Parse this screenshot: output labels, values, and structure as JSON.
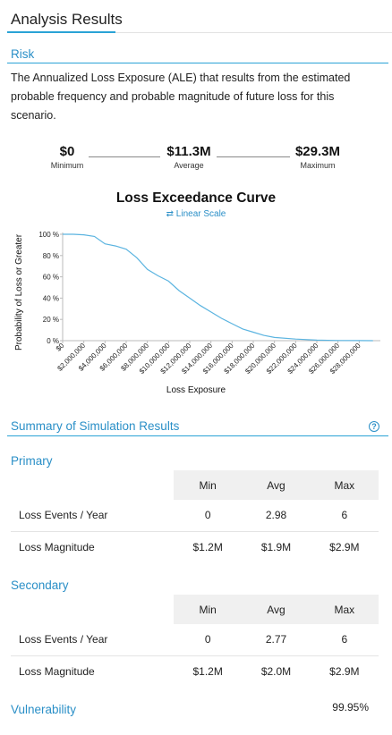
{
  "header": {
    "title": "Analysis Results"
  },
  "risk": {
    "heading": "Risk",
    "description": "The Annualized Loss Exposure (ALE) that results from the estimated probable frequency and probable magnitude of future loss for this scenario.",
    "stats": {
      "min_value": "$0",
      "min_label": "Minimum",
      "avg_value": "$11.3M",
      "avg_label": "Average",
      "max_value": "$29.3M",
      "max_label": "Maximum"
    }
  },
  "chart_data": {
    "type": "line",
    "title": "Loss Exceedance Curve",
    "scale_toggle": "Linear Scale",
    "xlabel": "Loss Exposure",
    "ylabel": "Probability of Loss or Greater",
    "x_ticks": [
      "$0",
      "$2,000,000",
      "$4,000,000",
      "$6,000,000",
      "$8,000,000",
      "$10,000,000",
      "$12,000,000",
      "$14,000,000",
      "$16,000,000",
      "$18,000,000",
      "$20,000,000",
      "$22,000,000",
      "$24,000,000",
      "$26,000,000",
      "$28,000,000"
    ],
    "y_ticks": [
      "0 %",
      "20 %",
      "40 %",
      "60 %",
      "80 %",
      "100 %"
    ],
    "xlim": [
      0,
      30000000
    ],
    "ylim": [
      0,
      100
    ],
    "grid": false,
    "series": [
      {
        "color": "#5bb4e0",
        "x": [
          0,
          1000000,
          2000000,
          3000000,
          4000000,
          5000000,
          6000000,
          7000000,
          8000000,
          9000000,
          10000000,
          11000000,
          12000000,
          13000000,
          14000000,
          15000000,
          16000000,
          17000000,
          18000000,
          19000000,
          20000000,
          22000000,
          24000000,
          26000000,
          28000000,
          29300000
        ],
        "y": [
          100,
          100,
          99.5,
          98,
          91,
          89,
          86,
          78,
          67,
          61,
          56,
          47,
          40,
          33,
          27,
          21,
          16,
          11,
          8,
          5,
          3,
          1.5,
          0.5,
          0.2,
          0.1,
          0
        ]
      }
    ]
  },
  "summary": {
    "heading": "Summary of Simulation Results",
    "help_icon": "help-icon",
    "primary": {
      "heading": "Primary",
      "columns": [
        "Min",
        "Avg",
        "Max"
      ],
      "rows": [
        {
          "label": "Loss Events / Year",
          "min": "0",
          "avg": "2.98",
          "max": "6"
        },
        {
          "label": "Loss Magnitude",
          "min": "$1.2M",
          "avg": "$1.9M",
          "max": "$2.9M"
        }
      ]
    },
    "secondary": {
      "heading": "Secondary",
      "columns": [
        "Min",
        "Avg",
        "Max"
      ],
      "rows": [
        {
          "label": "Loss Events / Year",
          "min": "0",
          "avg": "2.77",
          "max": "6"
        },
        {
          "label": "Loss Magnitude",
          "min": "$1.2M",
          "avg": "$2.0M",
          "max": "$2.9M"
        }
      ]
    },
    "vulnerability": {
      "label": "Vulnerability",
      "value": "99.95%"
    }
  }
}
